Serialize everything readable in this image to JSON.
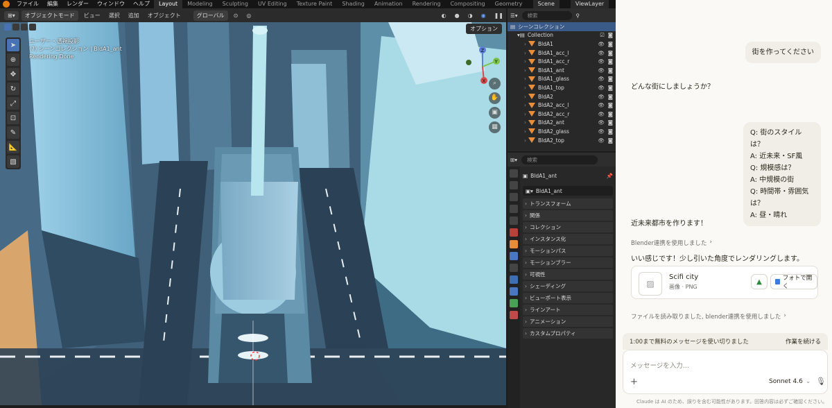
{
  "topbar": {
    "menu": [
      "ファイル",
      "編集",
      "レンダー",
      "ウィンドウ",
      "ヘルプ"
    ],
    "workspaces": [
      "Layout",
      "Modeling",
      "Sculpting",
      "UV Editing",
      "Texture Paint",
      "Shading",
      "Animation",
      "Rendering",
      "Compositing",
      "Geometry"
    ],
    "scene": "Scene",
    "viewlayer": "ViewLayer"
  },
  "viewport_header": {
    "mode": "オブジェクトモード",
    "menus": [
      "ビュー",
      "選択",
      "追加",
      "オブジェクト"
    ],
    "transform": "グローバル",
    "options": "オプション"
  },
  "viewport_info": {
    "line1": "ユーザー・透視投影",
    "line2": "(7) シーンコレクション | BldA1_ant",
    "line3": "Rendering Done"
  },
  "gizmo": {
    "z": "Z",
    "y": "Y",
    "x": "X"
  },
  "outliner": {
    "search_placeholder": "検索",
    "root": "シーンコレクション",
    "collection": "Collection",
    "items": [
      "BldA1",
      "BldA1_acc_l",
      "BldA1_acc_r",
      "BldA1_ant",
      "BldA1_glass",
      "BldA1_top",
      "BldA2",
      "BldA2_acc_l",
      "BldA2_acc_r",
      "BldA2_ant",
      "BldA2_glass",
      "BldA2_top"
    ]
  },
  "properties": {
    "search_placeholder": "検索",
    "object_name": "BldA1_ant",
    "data_name": "BldA1_ant",
    "sections": [
      "トランスフォーム",
      "関係",
      "コレクション",
      "インスタンス化",
      "モーションパス",
      "モーションブラー",
      "可視性",
      "シェーディング",
      "ビューポート表示",
      "ラインアート",
      "アニメーション",
      "カスタムプロパティ"
    ]
  },
  "chat": {
    "user1": "街を作ってください",
    "assistant1": "どんな街にしましょうか？",
    "user2": [
      "Q: 街のスタイルは？",
      "A: 近未来・SF風",
      "Q: 規模感は？",
      "A: 中規模の街",
      "Q: 時間帯・雰囲気は？",
      "A: 昼・晴れ"
    ],
    "assistant2": "近未来都市を作ります！",
    "tool1": "Blender連携を使用しました",
    "assistant3": "いい感じです！少し引いた角度でレンダリングします。",
    "file_title": "Scifi city",
    "file_meta": "画像 · PNG",
    "open_photos": "フォトで開く",
    "tool2": "ファイルを読み取りました, blender連携を使用しました",
    "limit_text": "1:00まで無料のメッセージを使い切りました",
    "continue_label": "作業を続ける",
    "input_placeholder": "メッセージを入力...",
    "model": "Sonnet 4.6",
    "disclaimer": "Claude は AI のため、誤りを含む可能性があります。回答内容は必ずご確認ください。"
  },
  "colors": {
    "accent": "#4772b3",
    "claude_bg": "#faf9f5",
    "bubble": "#f0eee6",
    "blender_orange": "#e87d0d"
  }
}
